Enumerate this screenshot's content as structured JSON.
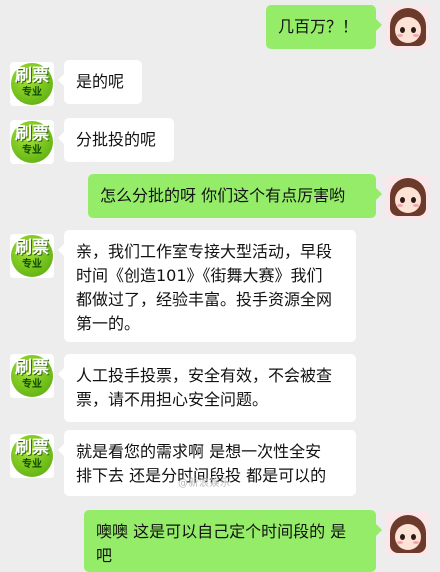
{
  "colors": {
    "background": "#ededed",
    "incoming_bubble": "#ffffff",
    "outgoing_bubble": "#95ec69"
  },
  "brand_avatar": {
    "line1": "刷票",
    "line2": "专业"
  },
  "messages": [
    {
      "side": "out",
      "text": "几百万？！"
    },
    {
      "side": "in",
      "text": "是的呢"
    },
    {
      "side": "in",
      "text": "分批投的呢"
    },
    {
      "side": "out",
      "text": "怎么分批的呀 你们这个有点厉害哟"
    },
    {
      "side": "in",
      "lines": [
        "亲，我们工作室专接大型活动，早段",
        "时间《创造101》《街舞大赛》我们",
        "都做过了，经验丰富。投手资源全网",
        "第一的。"
      ]
    },
    {
      "side": "in",
      "lines": [
        "人工投手投票，安全有效，不会被查",
        "票，请不用担心安全问题。"
      ]
    },
    {
      "side": "in",
      "lines": [
        "就是看您的需求啊 是想一次性全安",
        "排下去 还是分时间段投 都是可以的"
      ]
    },
    {
      "side": "out",
      "lines": [
        "噢噢 这是可以自己定个时间段的 是",
        "吧"
      ]
    }
  ],
  "watermark": "@新浪娱乐"
}
